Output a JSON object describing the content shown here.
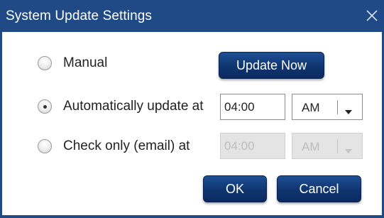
{
  "window": {
    "title": "System Update Settings"
  },
  "options": {
    "manual_label": "Manual",
    "auto_label": "Automatically update at",
    "check_label": "Check only (email) at",
    "selected": "auto"
  },
  "auto": {
    "time": "04:00",
    "ampm": "AM"
  },
  "check": {
    "time": "04:00",
    "ampm": "AM",
    "disabled": true
  },
  "buttons": {
    "update_now": "Update Now",
    "ok": "OK",
    "cancel": "Cancel"
  },
  "icons": {
    "close": "close-icon",
    "dropdown": "chevron-down-icon"
  },
  "colors": {
    "titlebar": "#1f4a86",
    "button": "#0f3570"
  }
}
